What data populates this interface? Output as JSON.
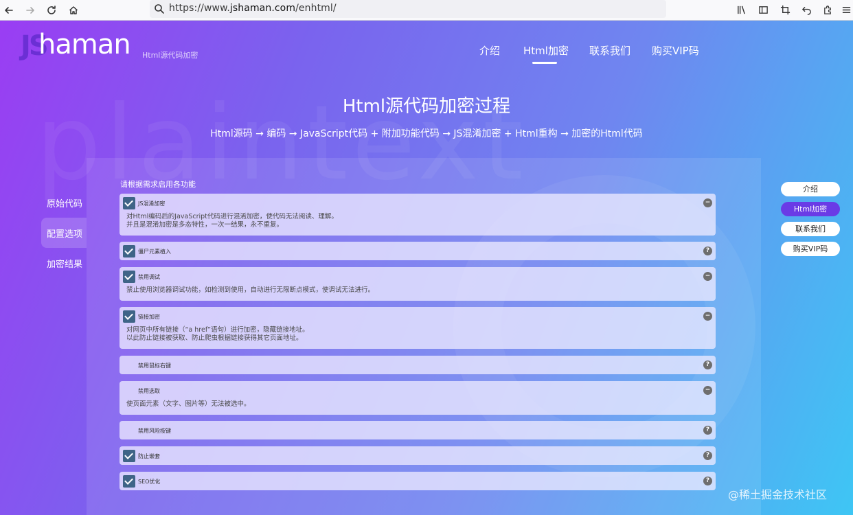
{
  "browser": {
    "url_prefix": "https://www.",
    "url_domain": "jshaman.com",
    "url_suffix": "/enhtml/"
  },
  "header": {
    "logo_js": "JS",
    "logo_name": "haman",
    "logo_subtitle": "Html源代码加密",
    "nav": [
      {
        "label": "介绍"
      },
      {
        "label": "Html加密",
        "active": true
      },
      {
        "label": "联系我们"
      },
      {
        "label": "购买VIP码"
      }
    ]
  },
  "hero": {
    "title": "Html源代码加密过程",
    "subtitle": "Html源码 → 编码 → JavaScript代码 + 附加功能代码 → JS混淆加密 + Html重构 → 加密的Html代码"
  },
  "watermark": "plaintext",
  "side_tabs": [
    {
      "label": "原始代码"
    },
    {
      "label": "配置选项",
      "active": true
    },
    {
      "label": "加密结果"
    }
  ],
  "options_title": "请根据需求启用各功能",
  "options": [
    {
      "label": "JS混淆加密",
      "checked": true,
      "expanded": true,
      "toggle": "−",
      "desc": [
        "对Html编码后的JavaScript代码进行混淆加密，使代码无法阅读、理解。",
        "并且是混淆加密是多态特性，一次一结果，永不重复。"
      ]
    },
    {
      "label": "僵尸元素植入",
      "checked": true,
      "expanded": false,
      "toggle": "?",
      "desc": []
    },
    {
      "label": "禁用调试",
      "checked": true,
      "expanded": true,
      "toggle": "−",
      "desc": [
        "禁止使用浏览器调试功能，如检测到使用，自动进行无限断点模式，使调试无法进行。"
      ]
    },
    {
      "label": "链接加密",
      "checked": true,
      "expanded": true,
      "toggle": "−",
      "desc": [
        "对网页中所有链接（“a href”语句）进行加密，隐藏链接地址。",
        "以此防止链接被获取、防止爬虫根据链接获得其它页面地址。"
      ]
    },
    {
      "label": "禁用鼠标右键",
      "checked": false,
      "expanded": false,
      "toggle": "?",
      "desc": []
    },
    {
      "label": "禁用选取",
      "checked": false,
      "expanded": true,
      "toggle": "−",
      "desc": [
        "使页面元素（文字、图片等）无法被选中。"
      ]
    },
    {
      "label": "禁用风险按键",
      "checked": false,
      "expanded": false,
      "toggle": "?",
      "desc": []
    },
    {
      "label": "防止嵌套",
      "checked": true,
      "expanded": false,
      "toggle": "?",
      "desc": []
    },
    {
      "label": "SEO优化",
      "checked": true,
      "expanded": false,
      "toggle": "?",
      "desc": []
    }
  ],
  "side_nav": [
    {
      "label": "介绍"
    },
    {
      "label": "Html加密",
      "active": true
    },
    {
      "label": "联系我们"
    },
    {
      "label": "购买VIP码"
    }
  ],
  "footer_mark": "@稀土掘金技术社区",
  "colors": {
    "accent": "#6a3be6",
    "check": "#3f6487"
  }
}
